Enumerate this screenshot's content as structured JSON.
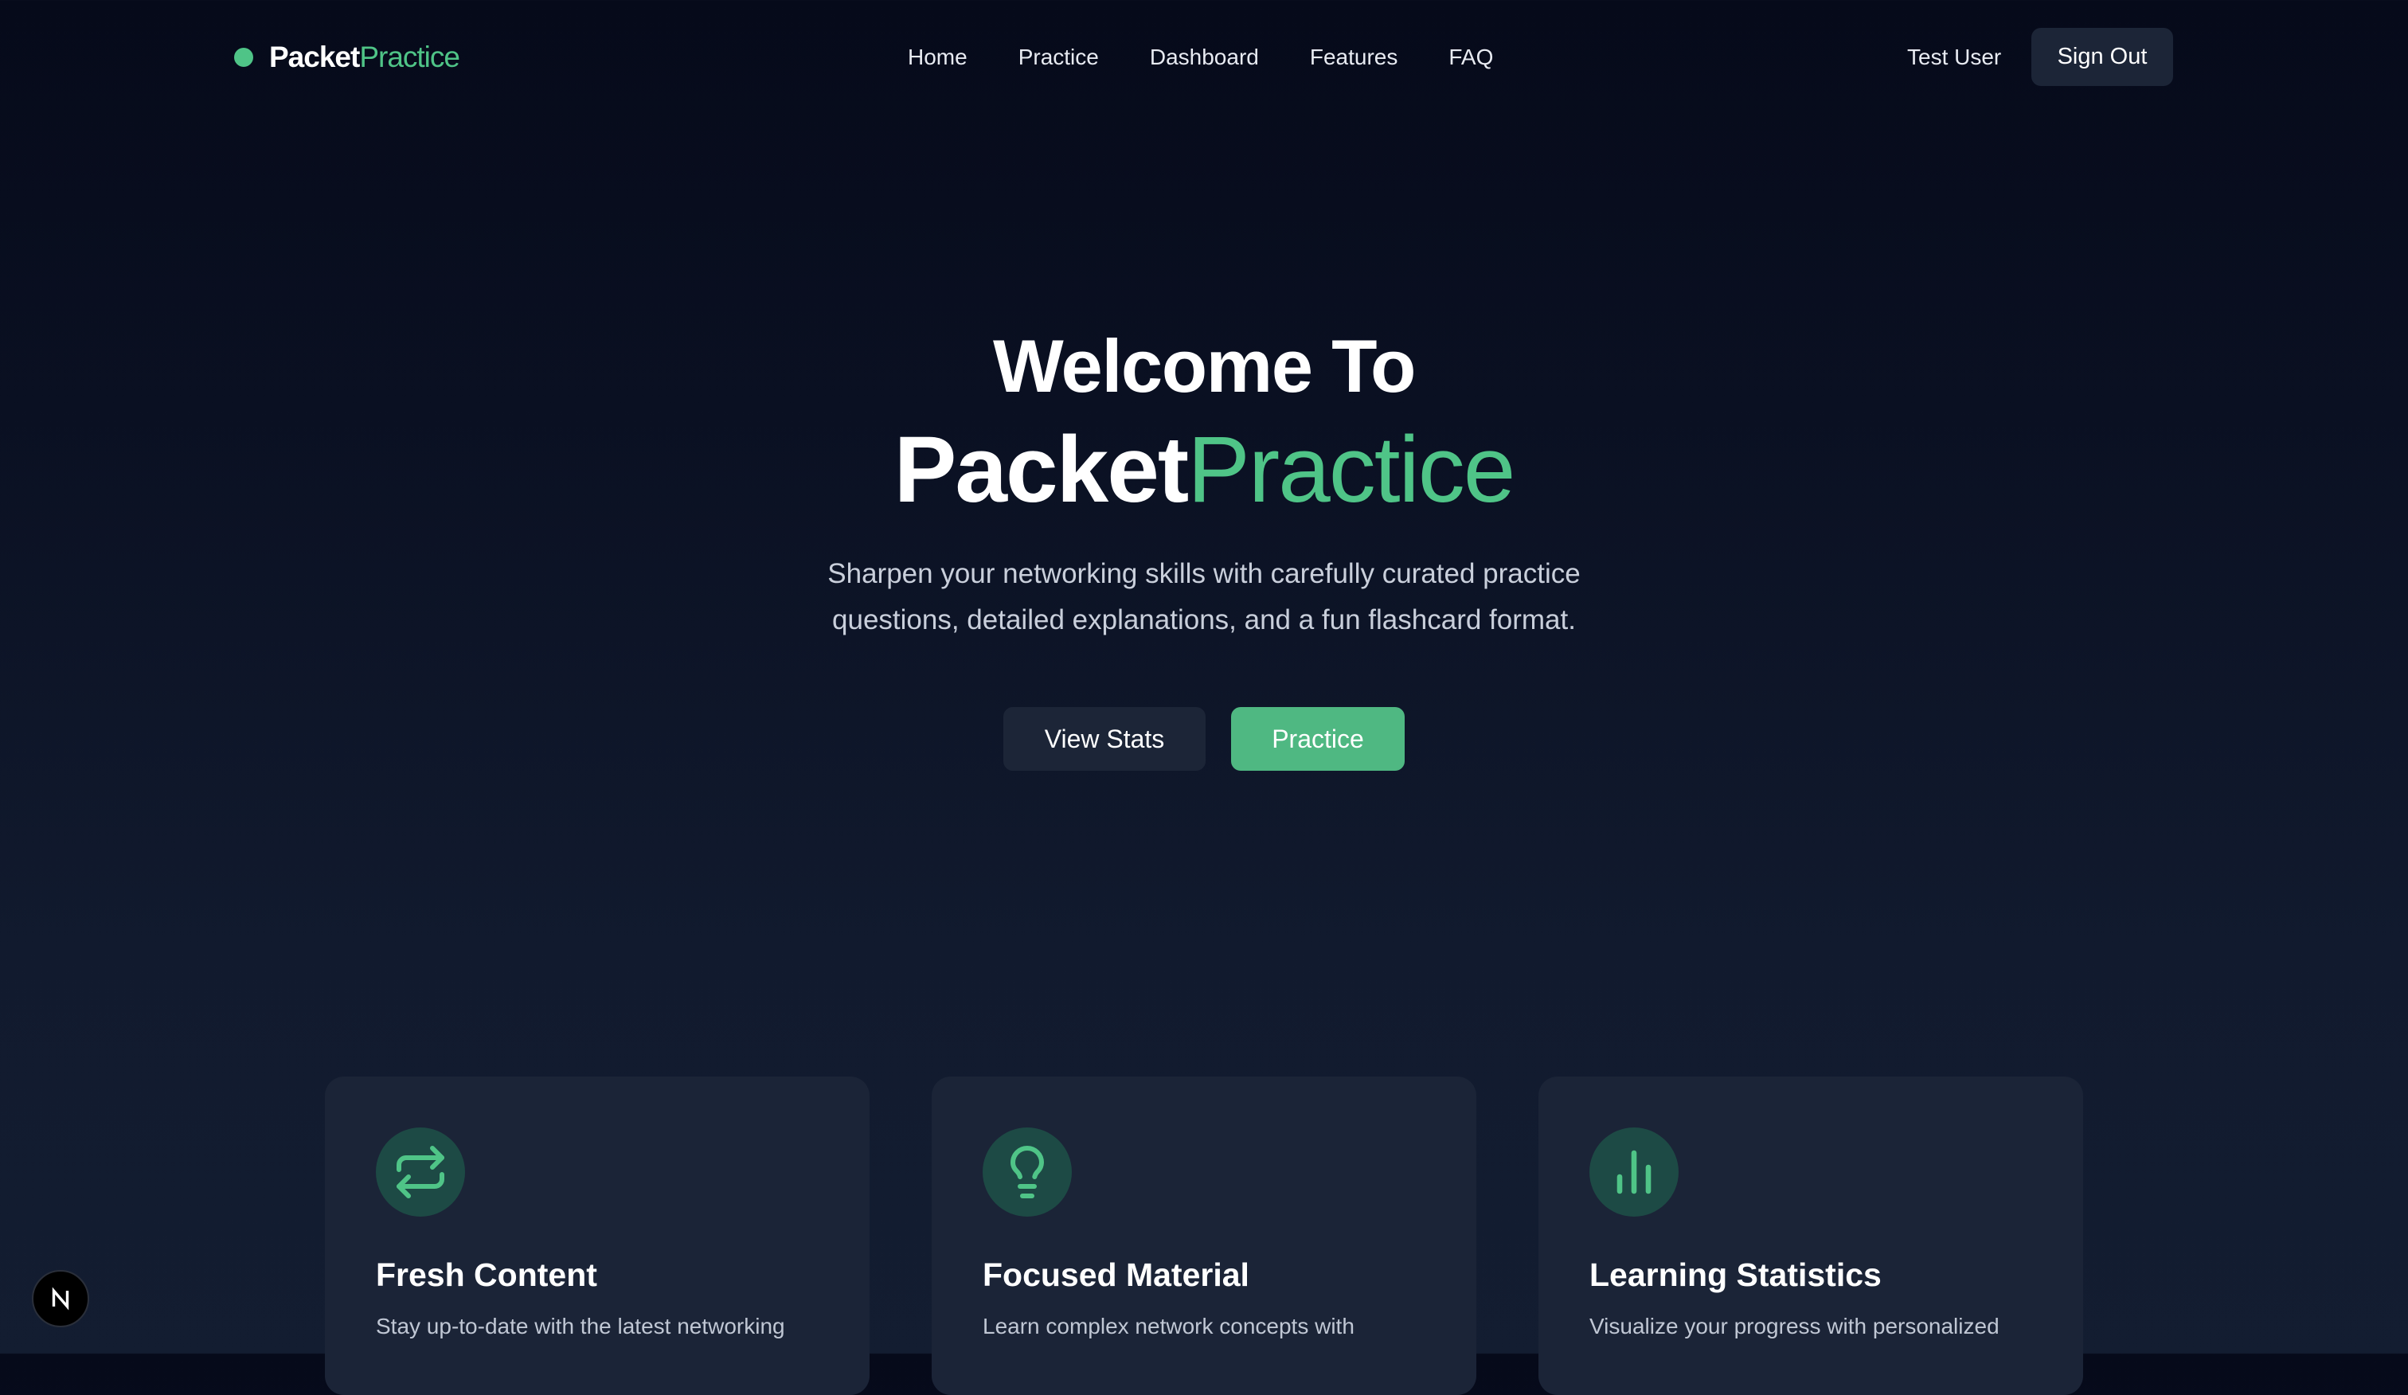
{
  "nav": {
    "logo": {
      "part1": "Packet",
      "part2": "Practice"
    },
    "links": [
      "Home",
      "Practice",
      "Dashboard",
      "Features",
      "FAQ"
    ],
    "user": "Test User",
    "sign_out": "Sign Out"
  },
  "hero": {
    "title_line1": "Welcome To",
    "title_part1": "Packet",
    "title_part2": "Practice",
    "subtitle": "Sharpen your networking skills with carefully curated practice questions, detailed explanations, and a fun flashcard format.",
    "btn_stats": "View Stats",
    "btn_practice": "Practice"
  },
  "features": [
    {
      "icon": "repeat-arrows-icon",
      "title": "Fresh Content",
      "desc": "Stay up-to-date with the latest networking"
    },
    {
      "icon": "lightbulb-icon",
      "title": "Focused Material",
      "desc": "Learn complex network concepts with"
    },
    {
      "icon": "bar-chart-icon",
      "title": "Learning Statistics",
      "desc": "Visualize your progress with personalized"
    }
  ],
  "colors": {
    "accent": "#4fc487",
    "background": "#0a1022",
    "card": "#1b2437",
    "button_dark": "#1c2537"
  },
  "badge": {
    "letter": "N"
  }
}
